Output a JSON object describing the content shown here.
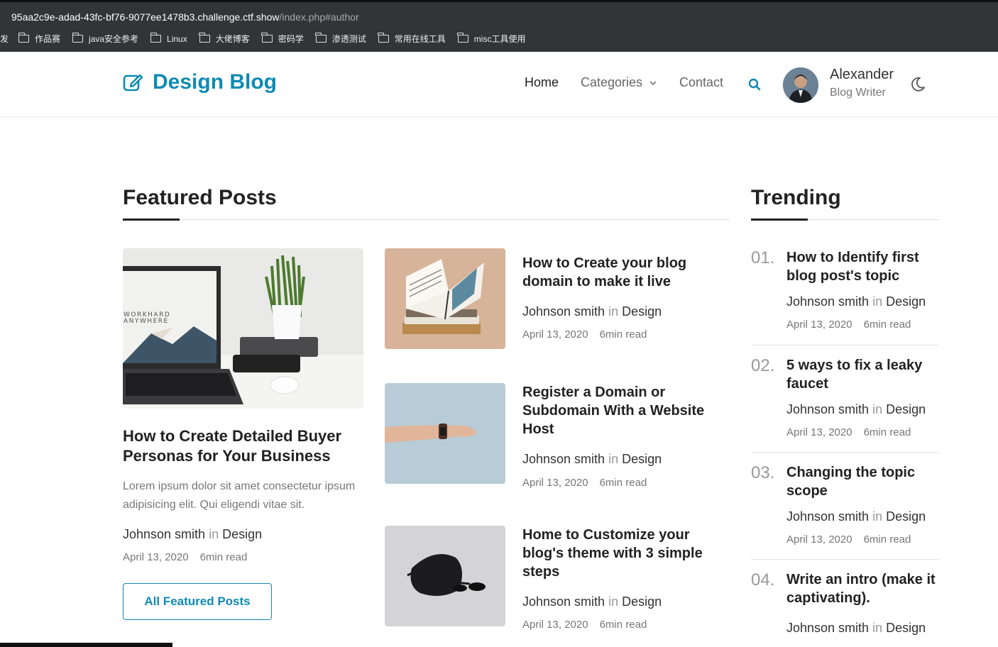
{
  "browser": {
    "url_host": "95aa2c9e-adad-43fc-bf76-9077ee1478b3.challenge.ctf.show",
    "url_path": "/index.php#author",
    "bookmark_cut": "发",
    "bookmarks": [
      "作品赛",
      "java安全参考",
      "Linux",
      "大佬博客",
      "密码学",
      "渗透测试",
      "常用在线工具",
      "misc工具使用"
    ]
  },
  "header": {
    "logo": "Design Blog",
    "nav": {
      "home": "Home",
      "categories": "Categories",
      "contact": "Contact"
    },
    "author": {
      "name": "Alexander",
      "role": "Blog Writer"
    },
    "icons": [
      "edit-icon",
      "chevron-down-icon",
      "search-icon",
      "moon-icon"
    ]
  },
  "featured": {
    "heading": "Featured Posts",
    "main_post": {
      "title": "How to Create Detailed Buyer Personas for Your Business",
      "excerpt": "Lorem ipsum dolor sit amet consectetur ipsum adipisicing elit. Qui eligendi vitae sit.",
      "author": "Johnson smith",
      "in": "in",
      "category": "Design",
      "date": "April 13, 2020",
      "read": "6min read",
      "image_text": [
        "WORKHARD",
        "ANYWHERE"
      ]
    },
    "side_posts": [
      {
        "title": "How to Create your blog domain to make it live",
        "author": "Johnson smith",
        "in": "in",
        "category": "Design",
        "date": "April 13, 2020",
        "read": "6min read"
      },
      {
        "title": "Register a Domain or Subdomain With a Website Host",
        "author": "Johnson smith",
        "in": "in",
        "category": "Design",
        "date": "April 13, 2020",
        "read": "6min read"
      },
      {
        "title": "Home to Customize your blog's theme with 3 simple steps",
        "author": "Johnson smith",
        "in": "in",
        "category": "Design",
        "date": "April 13, 2020",
        "read": "6min read"
      }
    ],
    "button": "All Featured Posts"
  },
  "trending": {
    "heading": "Trending",
    "items": [
      {
        "num": "01.",
        "title": "How to Identify first blog post's topic",
        "author": "Johnson smith",
        "in": "in",
        "category": "Design",
        "date": "April 13, 2020",
        "read": "6min read"
      },
      {
        "num": "02.",
        "title": "5 ways to fix a leaky faucet",
        "author": "Johnson smith",
        "in": "in",
        "category": "Design",
        "date": "April 13, 2020",
        "read": "6min read"
      },
      {
        "num": "03.",
        "title": "Changing the topic scope",
        "author": "Johnson smith",
        "in": "in",
        "category": "Design",
        "date": "April 13, 2020",
        "read": "6min read"
      },
      {
        "num": "04.",
        "title": "Write an intro (make it captivating).",
        "author": "Johnson smith",
        "in": "in",
        "category": "Design"
      }
    ]
  },
  "colors": {
    "accent": "#0f8ab3",
    "chrome": "#333437",
    "text": "#222222",
    "muted": "#777777"
  }
}
